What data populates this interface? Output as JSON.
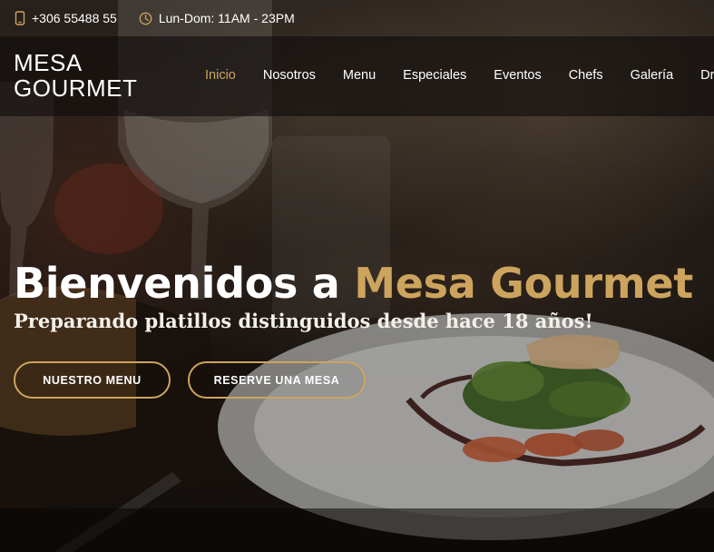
{
  "colors": {
    "accent": "#cda45e",
    "header_bg": "#0e0c0b"
  },
  "topbar": {
    "phone_icon": "phone-icon",
    "phone": "+306 55488 55",
    "clock_icon": "clock-icon",
    "hours": "Lun-Dom: 11AM - 23PM"
  },
  "header": {
    "logo_line1": "MESA",
    "logo_line2": "GOURMET",
    "nav": [
      "Inicio",
      "Nosotros",
      "Menu",
      "Especiales",
      "Eventos",
      "Chefs",
      "Galería",
      "Drop"
    ],
    "active_nav": "Inicio"
  },
  "hero": {
    "title_prefix": "Bienvenidos a ",
    "title_accent": "Mesa Gourmet",
    "subtitle": "Preparando platillos distinguidos desde hace 18 años!",
    "btn_menu": "NUESTRO MENU",
    "btn_reserve": "RESERVE UNA MESA"
  }
}
